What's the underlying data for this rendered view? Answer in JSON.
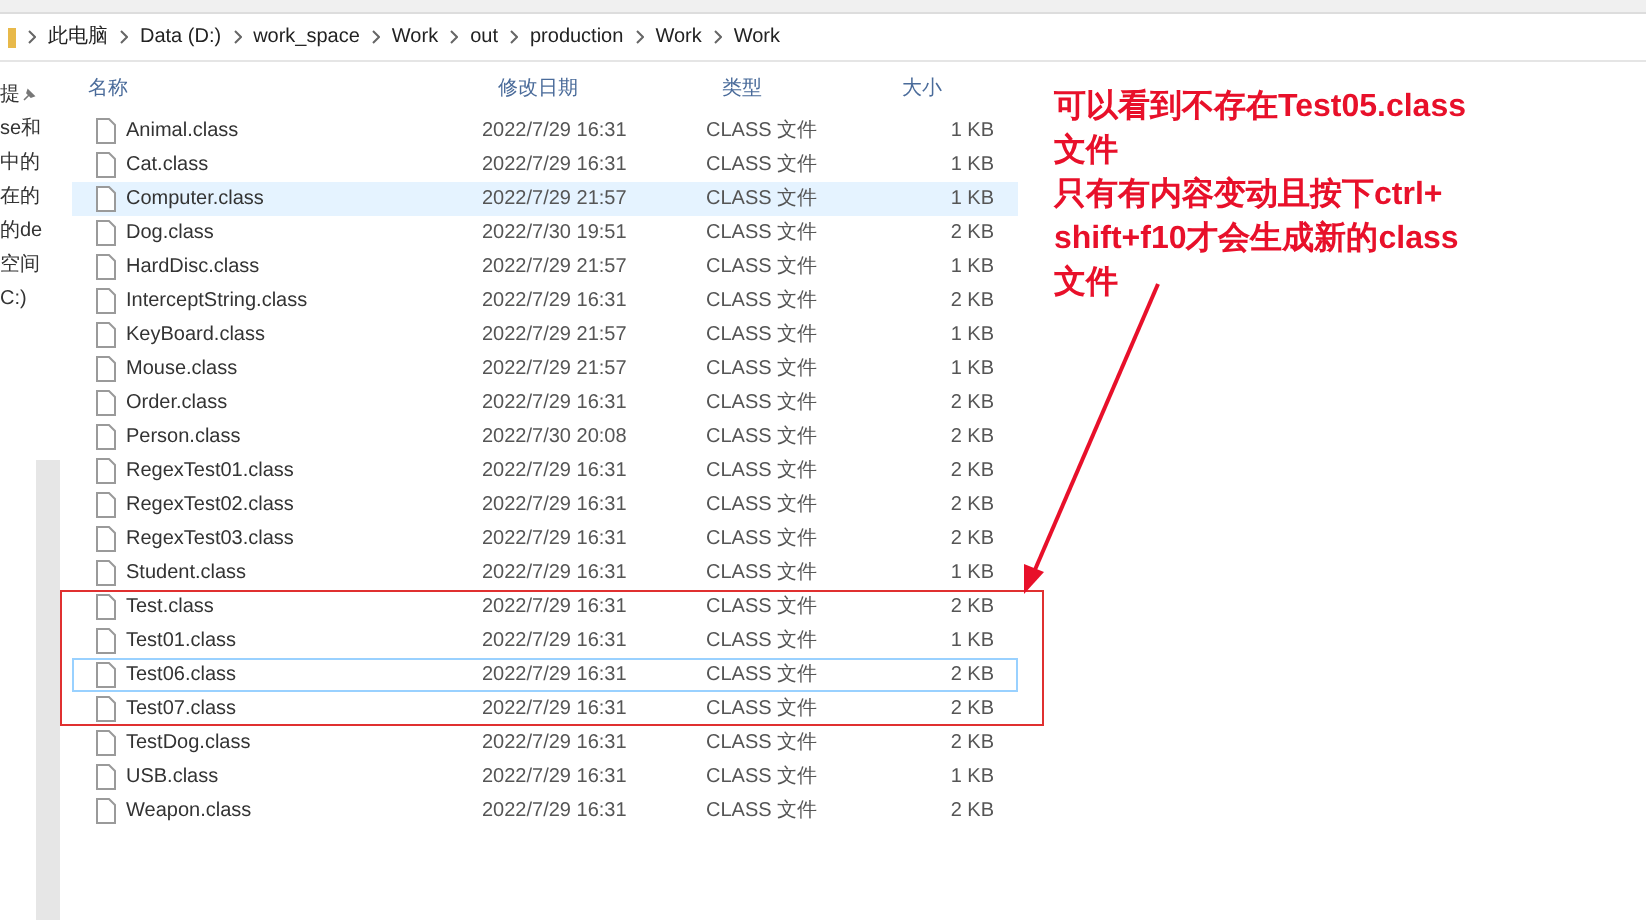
{
  "breadcrumb": [
    "此电脑",
    "Data (D:)",
    "work_space",
    "Work",
    "out",
    "production",
    "Work",
    "Work"
  ],
  "sidebar": {
    "items": [
      {
        "label": "提",
        "pinned": true
      },
      {
        "label": "se和",
        "pinned": false
      },
      {
        "label": "中的",
        "pinned": false
      },
      {
        "label": "在的",
        "pinned": false
      },
      {
        "label": "的de",
        "pinned": false
      },
      {
        "label": "空间",
        "pinned": false
      },
      {
        "label": "C:)",
        "pinned": false
      }
    ]
  },
  "columns": [
    "名称",
    "修改日期",
    "类型",
    "大小"
  ],
  "rows": [
    {
      "name": "Animal.class",
      "date": "2022/7/29 16:31",
      "type": "CLASS 文件",
      "size": "1 KB",
      "selected": false,
      "focused": false,
      "boxed": false
    },
    {
      "name": "Cat.class",
      "date": "2022/7/29 16:31",
      "type": "CLASS 文件",
      "size": "1 KB",
      "selected": false,
      "focused": false,
      "boxed": false
    },
    {
      "name": "Computer.class",
      "date": "2022/7/29 21:57",
      "type": "CLASS 文件",
      "size": "1 KB",
      "selected": true,
      "focused": false,
      "boxed": false
    },
    {
      "name": "Dog.class",
      "date": "2022/7/30 19:51",
      "type": "CLASS 文件",
      "size": "2 KB",
      "selected": false,
      "focused": false,
      "boxed": false
    },
    {
      "name": "HardDisc.class",
      "date": "2022/7/29 21:57",
      "type": "CLASS 文件",
      "size": "1 KB",
      "selected": false,
      "focused": false,
      "boxed": false
    },
    {
      "name": "InterceptString.class",
      "date": "2022/7/29 16:31",
      "type": "CLASS 文件",
      "size": "2 KB",
      "selected": false,
      "focused": false,
      "boxed": false
    },
    {
      "name": "KeyBoard.class",
      "date": "2022/7/29 21:57",
      "type": "CLASS 文件",
      "size": "1 KB",
      "selected": false,
      "focused": false,
      "boxed": false
    },
    {
      "name": "Mouse.class",
      "date": "2022/7/29 21:57",
      "type": "CLASS 文件",
      "size": "1 KB",
      "selected": false,
      "focused": false,
      "boxed": false
    },
    {
      "name": "Order.class",
      "date": "2022/7/29 16:31",
      "type": "CLASS 文件",
      "size": "2 KB",
      "selected": false,
      "focused": false,
      "boxed": false
    },
    {
      "name": "Person.class",
      "date": "2022/7/30 20:08",
      "type": "CLASS 文件",
      "size": "2 KB",
      "selected": false,
      "focused": false,
      "boxed": false
    },
    {
      "name": "RegexTest01.class",
      "date": "2022/7/29 16:31",
      "type": "CLASS 文件",
      "size": "2 KB",
      "selected": false,
      "focused": false,
      "boxed": false
    },
    {
      "name": "RegexTest02.class",
      "date": "2022/7/29 16:31",
      "type": "CLASS 文件",
      "size": "2 KB",
      "selected": false,
      "focused": false,
      "boxed": false
    },
    {
      "name": "RegexTest03.class",
      "date": "2022/7/29 16:31",
      "type": "CLASS 文件",
      "size": "2 KB",
      "selected": false,
      "focused": false,
      "boxed": false
    },
    {
      "name": "Student.class",
      "date": "2022/7/29 16:31",
      "type": "CLASS 文件",
      "size": "1 KB",
      "selected": false,
      "focused": false,
      "boxed": false
    },
    {
      "name": "Test.class",
      "date": "2022/7/29 16:31",
      "type": "CLASS 文件",
      "size": "2 KB",
      "selected": false,
      "focused": false,
      "boxed": true
    },
    {
      "name": "Test01.class",
      "date": "2022/7/29 16:31",
      "type": "CLASS 文件",
      "size": "1 KB",
      "selected": false,
      "focused": false,
      "boxed": true
    },
    {
      "name": "Test06.class",
      "date": "2022/7/29 16:31",
      "type": "CLASS 文件",
      "size": "2 KB",
      "selected": false,
      "focused": true,
      "boxed": true
    },
    {
      "name": "Test07.class",
      "date": "2022/7/29 16:31",
      "type": "CLASS 文件",
      "size": "2 KB",
      "selected": false,
      "focused": false,
      "boxed": true
    },
    {
      "name": "TestDog.class",
      "date": "2022/7/29 16:31",
      "type": "CLASS 文件",
      "size": "2 KB",
      "selected": false,
      "focused": false,
      "boxed": false
    },
    {
      "name": "USB.class",
      "date": "2022/7/29 16:31",
      "type": "CLASS 文件",
      "size": "1 KB",
      "selected": false,
      "focused": false,
      "boxed": false
    },
    {
      "name": "Weapon.class",
      "date": "2022/7/29 16:31",
      "type": "CLASS 文件",
      "size": "2 KB",
      "selected": false,
      "focused": false,
      "boxed": false
    }
  ],
  "annotation": [
    "可以看到不存在Test05.class",
    "文件",
    "只有有内容变动且按下ctrl+",
    "shift+f10才会生成新的class",
    "文件"
  ]
}
